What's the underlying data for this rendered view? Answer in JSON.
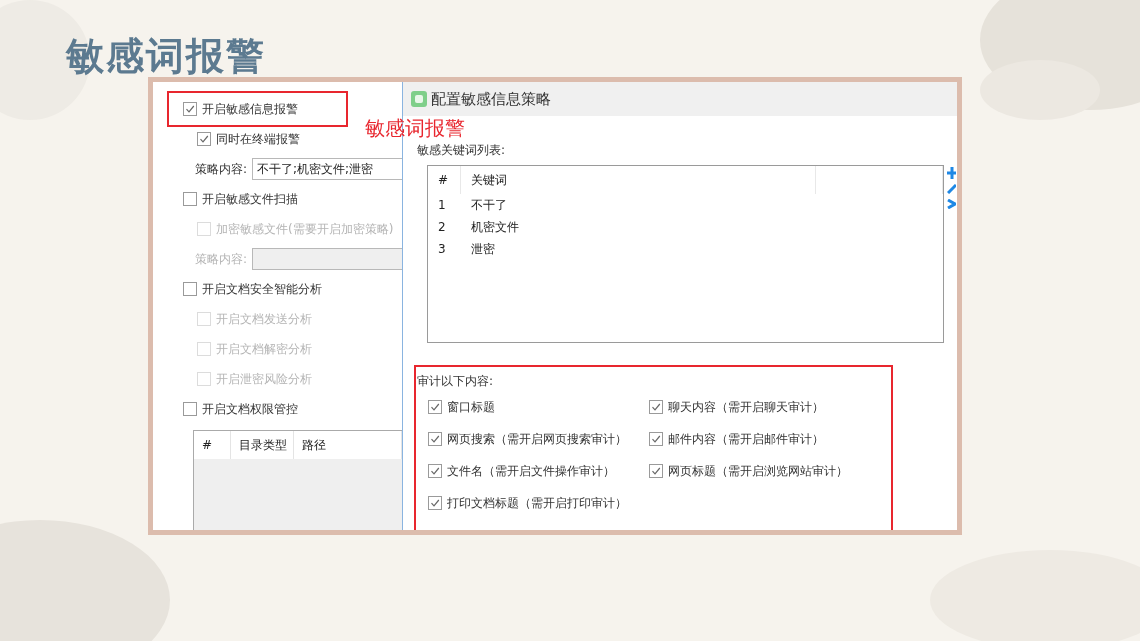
{
  "slide_title": "敏感词报警",
  "annotation": {
    "label": "敏感词报警"
  },
  "settings_panel": {
    "items": [
      {
        "kind": "checkbox",
        "label": "开启敏感信息报警",
        "checked": true,
        "disabled": false,
        "highlighted": true,
        "children": [
          {
            "kind": "checkbox",
            "label": "同时在终端报警",
            "checked": true,
            "disabled": false
          },
          {
            "kind": "field",
            "label": "策略内容:",
            "value": "不干了;机密文件;泄密",
            "disabled": false
          }
        ]
      },
      {
        "kind": "checkbox",
        "label": "开启敏感文件扫描",
        "checked": false,
        "disabled": false,
        "highlighted": false,
        "children": [
          {
            "kind": "checkbox",
            "label": "加密敏感文件(需要开启加密策略)",
            "checked": false,
            "disabled": true
          },
          {
            "kind": "field",
            "label": "策略内容:",
            "disabled": true
          }
        ]
      },
      {
        "kind": "checkbox",
        "label": "开启文档安全智能分析",
        "checked": false,
        "disabled": false,
        "highlighted": false,
        "children": [
          {
            "kind": "checkbox",
            "label": "开启文档发送分析",
            "checked": false,
            "disabled": true
          },
          {
            "kind": "checkbox",
            "label": "开启文档解密分析",
            "checked": false,
            "disabled": true
          },
          {
            "kind": "checkbox",
            "label": "开启泄密风险分析",
            "checked": false,
            "disabled": true
          }
        ]
      },
      {
        "kind": "checkbox",
        "label": "开启文档权限管控",
        "checked": false,
        "disabled": false,
        "highlighted": false,
        "children": [
          {
            "kind": "table",
            "columns": [
              "#",
              "目录类型",
              "路径"
            ]
          }
        ]
      }
    ]
  },
  "dialog": {
    "title": "配置敏感信息策略",
    "keywords": {
      "label": "敏感关键词列表:",
      "columns": [
        "#",
        "关键词"
      ],
      "rows": [
        [
          "1",
          "不干了"
        ],
        [
          "2",
          "机密文件"
        ],
        [
          "3",
          "泄密"
        ]
      ]
    },
    "audit": {
      "label": "审计以下内容:",
      "options": [
        {
          "label": "窗口标题",
          "checked": true
        },
        {
          "label": "聊天内容（需开启聊天审计）",
          "checked": true
        },
        {
          "label": "网页搜索（需开启网页搜索审计）",
          "checked": true
        },
        {
          "label": "邮件内容（需开启邮件审计）",
          "checked": true
        },
        {
          "label": "文件名（需开启文件操作审计）",
          "checked": true
        },
        {
          "label": "网页标题（需开启浏览网站审计）",
          "checked": true
        },
        {
          "label": "打印文档标题（需开启打印审计）",
          "checked": true
        }
      ]
    }
  }
}
